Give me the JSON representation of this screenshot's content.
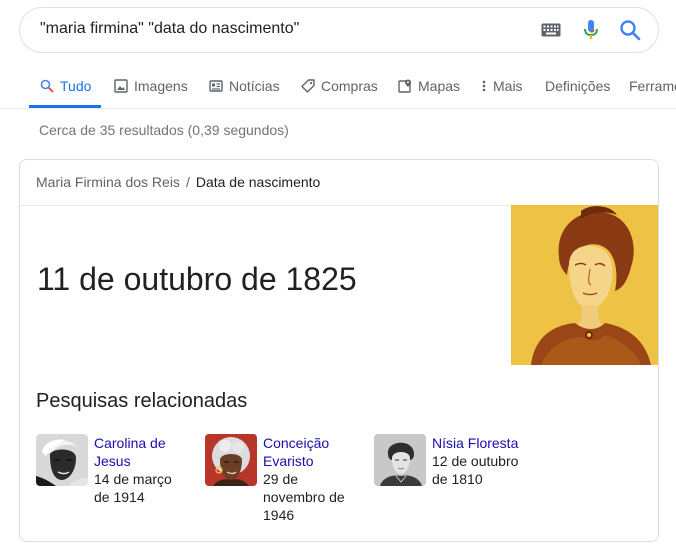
{
  "search": {
    "query": "\"maria firmina\" \"data do nascimento\""
  },
  "tabs": [
    {
      "label": "Tudo",
      "icon": "search-icon"
    },
    {
      "label": "Imagens",
      "icon": "image-icon"
    },
    {
      "label": "Notícias",
      "icon": "news-icon"
    },
    {
      "label": "Compras",
      "icon": "tag-icon"
    },
    {
      "label": "Mapas",
      "icon": "map-pin-icon"
    },
    {
      "label": "Mais",
      "icon": "more-vert-icon"
    },
    {
      "label": "Definições"
    },
    {
      "label": "Ferramentas"
    }
  ],
  "stats": "Cerca de 35 resultados (0,39 segundos)",
  "card": {
    "breadcrumb": {
      "entity": "Maria Firmina dos Reis",
      "separator": "/",
      "attribute": "Data de nascimento"
    },
    "answer": "11 de outubro de 1825",
    "related_title": "Pesquisas relacionadas",
    "related": [
      {
        "name_line1": "Carolina de",
        "name_line2": "Jesus",
        "date_line1": "14 de março",
        "date_line2": "de 1914"
      },
      {
        "name_line1": "Conceição",
        "name_line2": "Evaristo",
        "date_line1": "29 de",
        "date_line2": "novembro de",
        "date_line3": "1946"
      },
      {
        "name_line1": "Nísia Floresta",
        "date_line1": "12 de outubro",
        "date_line2": "de 1810"
      }
    ]
  },
  "colors": {
    "accent": "#1a73e8",
    "link": "#1a0dab",
    "muted": "#5f6368",
    "portrait_bg": "#f2c94c"
  }
}
